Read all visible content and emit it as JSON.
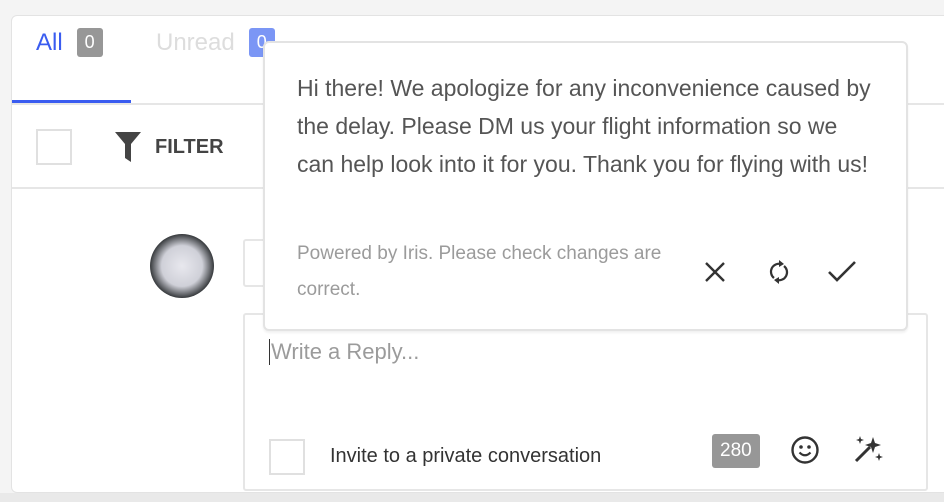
{
  "tabs": [
    {
      "label": "All",
      "count": "0",
      "active": true
    },
    {
      "label": "Unread",
      "count": "0",
      "active": false
    }
  ],
  "toolbar": {
    "filter_label": "FILTER"
  },
  "reply": {
    "placeholder": "Write a Reply...",
    "invite_label": "Invite to a private conversation",
    "char_count": "280"
  },
  "suggestion": {
    "message": "Hi there! We apologize for any inconvenience caused by the delay. Please DM us your flight information so we can help look into it for you. Thank you for flying with us!",
    "powered_by": "Powered by Iris. Please check changes are correct."
  },
  "colors": {
    "accent": "#3a5cf0",
    "badge": "#979797",
    "unread_badge": "#7b96f5"
  }
}
